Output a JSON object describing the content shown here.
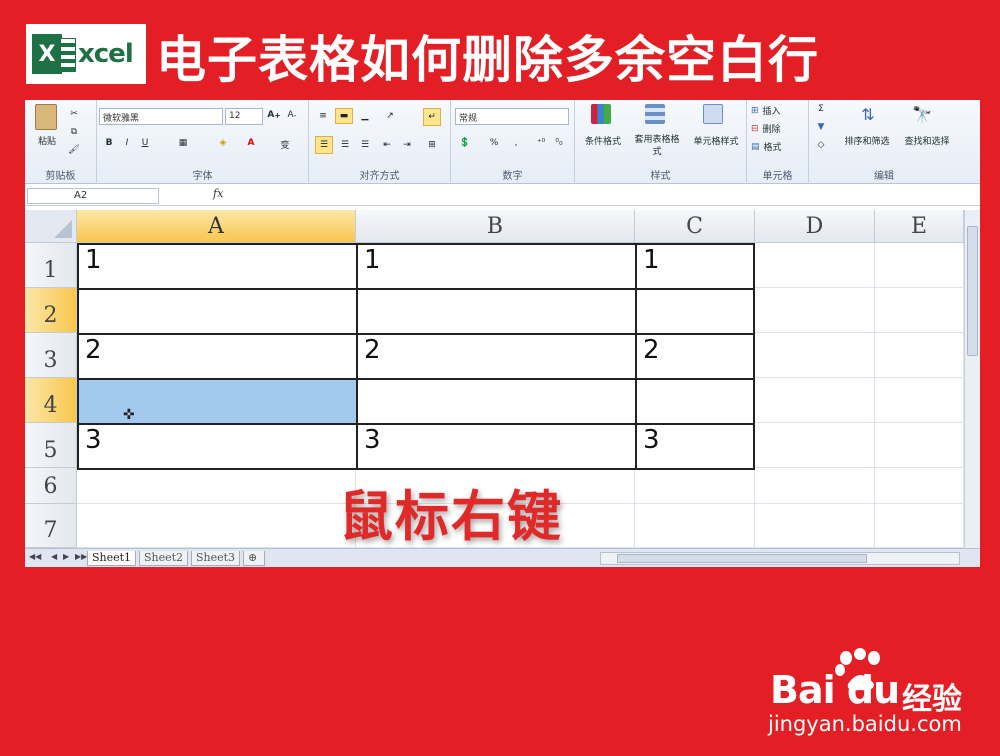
{
  "banner": {
    "logo_letter": "X",
    "logo_text": "xcel",
    "title": "电子表格如何删除多余空白行"
  },
  "ribbon": {
    "clipboard": {
      "paste": "粘贴",
      "label": "剪贴板"
    },
    "font": {
      "name": "微软雅黑",
      "size": "12",
      "bold": "B",
      "italic": "I",
      "underline": "U",
      "label": "字体"
    },
    "alignment": {
      "label": "对齐方式"
    },
    "number": {
      "format": "常规",
      "percent": "%",
      "label": "数字"
    },
    "styles": {
      "conditional": "条件格式",
      "table": "套用表格格式",
      "cell_style": "单元格样式",
      "label": "样式"
    },
    "cells": {
      "insert": "插入",
      "delete": "删除",
      "format": "格式",
      "label": "单元格"
    },
    "editing": {
      "sort": "排序和筛选",
      "find": "查找和选择",
      "label": "编辑"
    }
  },
  "formula_bar": {
    "name_box": "A2",
    "fx": "fx"
  },
  "columns": [
    "A",
    "B",
    "C",
    "D",
    "E"
  ],
  "rows": [
    {
      "num": "1",
      "a": "1",
      "b": "1",
      "c": "1"
    },
    {
      "num": "2",
      "a": "",
      "b": "",
      "c": ""
    },
    {
      "num": "3",
      "a": "2",
      "b": "2",
      "c": "2"
    },
    {
      "num": "4",
      "a": "",
      "b": "",
      "c": ""
    },
    {
      "num": "5",
      "a": "3",
      "b": "3",
      "c": "3"
    },
    {
      "num": "6",
      "a": "",
      "b": "",
      "c": ""
    },
    {
      "num": "7",
      "a": "",
      "b": "",
      "c": ""
    }
  ],
  "overlay_text": "鼠标右键",
  "sheets": [
    "Sheet1",
    "Sheet2",
    "Sheet3"
  ],
  "watermark": {
    "brand": "Bai du",
    "jingyan": "经验",
    "url": "jingyan.baidu.com"
  },
  "colors": {
    "background": "#e41e25",
    "excel_green": "#1e7145",
    "selection": "#a3c9ee",
    "active_header": "#f7c64d"
  }
}
